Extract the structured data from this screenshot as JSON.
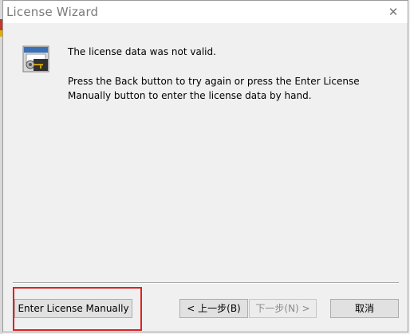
{
  "window": {
    "title": "License Wizard",
    "close_glyph": "✕"
  },
  "message": {
    "headline": "The license data was not valid.",
    "detail": "Press the Back button to try again or press the Enter License Manually button to enter the license data by hand."
  },
  "buttons": {
    "enter_manually": "Enter License Manually",
    "back": "< 上一步(B)",
    "next": "下一步(N) >",
    "cancel": "取消"
  },
  "icons": {
    "wizard": "license-key-icon",
    "close": "close-icon"
  },
  "colors": {
    "highlight": "#e02020",
    "window_bg": "#f0f0f0"
  }
}
